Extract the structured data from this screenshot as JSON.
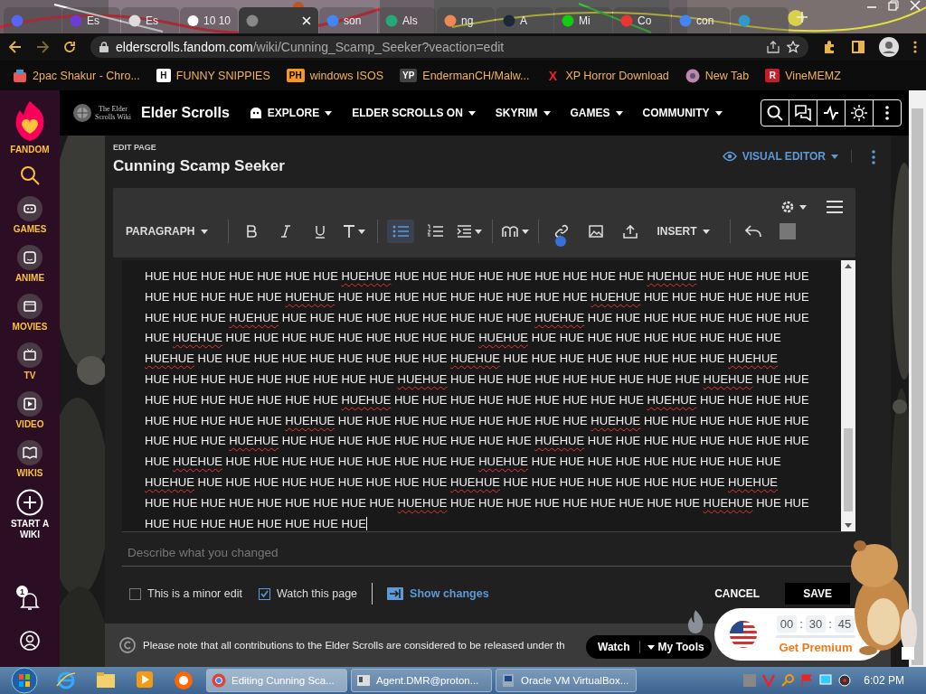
{
  "browser": {
    "tabs": [
      {
        "selected": false
      },
      {
        "label": "Es",
        "selected": false
      },
      {
        "label": "Es",
        "selected": false
      },
      {
        "label": "10 10",
        "selected": false
      },
      {
        "selected": true
      },
      {
        "label": "son",
        "selected": false
      },
      {
        "label": "Als",
        "selected": false
      },
      {
        "label": "ng",
        "selected": false
      },
      {
        "label": "A",
        "selected": false
      },
      {
        "label": "Mi",
        "selected": false
      },
      {
        "label": "Co",
        "selected": false
      },
      {
        "label": "con",
        "selected": false
      },
      {
        "selected": false
      }
    ],
    "url_host": "elderscrolls.fandom.com",
    "url_path": "/wiki/Cunning_Scamp_Seeker?veaction=edit",
    "bookmarks": [
      {
        "label": "2pac Shakur - Chro..."
      },
      {
        "label": "FUNNY SNIPPIES",
        "icon_text": "H"
      },
      {
        "label": "windows ISOS",
        "icon_text": "PH"
      },
      {
        "label": "EndermanCH/Malw...",
        "icon_text": "YP"
      },
      {
        "label": "XP Horror Download",
        "icon_text": "X"
      },
      {
        "label": "New Tab"
      },
      {
        "label": "VineMEMZ",
        "icon_text": "R"
      }
    ]
  },
  "rail": {
    "brand": "FANDOM",
    "items": [
      {
        "label": "GAMES",
        "kind": "games"
      },
      {
        "label": "ANIME",
        "kind": "anime"
      },
      {
        "label": "MOVIES",
        "kind": "movies"
      },
      {
        "label": "TV",
        "kind": "tv"
      },
      {
        "label": "VIDEO",
        "kind": "video"
      },
      {
        "label": "WIKIS",
        "kind": "wikis"
      },
      {
        "label": "START A WIKI",
        "kind": "start"
      }
    ],
    "notification_count": "1"
  },
  "nav": {
    "logo": "The Elder Scrolls Wiki",
    "site": "Elder Scrolls",
    "menus": [
      "EXPLORE",
      "ELDER SCROLLS ON",
      "SKYRIM",
      "GAMES",
      "COMMUNITY"
    ]
  },
  "editor": {
    "overline": "EDIT PAGE",
    "title": "Cunning Scamp Seeker",
    "mode": "VISUAL EDITOR",
    "format": "PARAGRAPH",
    "insert": "INSERT",
    "lists": [
      {
        "kind": "bullet",
        "selected": true
      },
      {
        "kind": "numbered",
        "selected": false
      }
    ],
    "lines": [
      [
        {
          "text": "HUE HUE HUE HUE HUE HUE HUE ",
          "misspelled": false
        },
        {
          "text": "HUEHUE",
          "misspelled": true
        },
        {
          "text": " HUE HUE HUE HUE HUE HUE HUE HUE HUE ",
          "misspelled": false
        },
        {
          "text": "HUEHUE",
          "misspelled": true
        },
        {
          "text": " HUE HUE HUE HUE",
          "misspelled": false
        }
      ],
      [
        {
          "text": "HUE HUE HUE HUE HUE ",
          "misspelled": false
        },
        {
          "text": "HUEHUE",
          "misspelled": true
        },
        {
          "text": " HUE HUE HUE HUE HUE HUE HUE HUE HUE ",
          "misspelled": false
        },
        {
          "text": "HUEHUE",
          "misspelled": true
        },
        {
          "text": " HUE HUE HUE HUE HUE HUE",
          "misspelled": false
        }
      ],
      [
        {
          "text": "HUE HUE HUE ",
          "misspelled": false
        },
        {
          "text": "HUEHUE",
          "misspelled": true
        },
        {
          "text": " HUE HUE HUE HUE HUE HUE HUE HUE HUE ",
          "misspelled": false
        },
        {
          "text": "HUEHUE",
          "misspelled": true
        },
        {
          "text": " HUE HUE HUE HUE HUE HUE HUE HUE",
          "misspelled": false
        }
      ],
      [
        {
          "text": "HUE ",
          "misspelled": false
        },
        {
          "text": "HUEHUE",
          "misspelled": true
        },
        {
          "text": " HUE HUE HUE HUE HUE HUE HUE HUE HUE ",
          "misspelled": false
        },
        {
          "text": "HUEHUE",
          "misspelled": true
        },
        {
          "text": " HUE HUE HUE HUE HUE HUE HUE HUE HUE",
          "misspelled": false
        }
      ],
      [
        {
          "text": "HUEHUE",
          "misspelled": true
        },
        {
          "text": " HUE HUE HUE HUE HUE HUE HUE HUE HUE ",
          "misspelled": false
        },
        {
          "text": "HUEHUE",
          "misspelled": true
        },
        {
          "text": " HUE HUE HUE HUE HUE HUE HUE HUE ",
          "misspelled": false
        },
        {
          "text": "HUEHUE",
          "misspelled": true
        }
      ],
      [
        {
          "text": "HUE HUE HUE HUE HUE HUE HUE HUE HUE ",
          "misspelled": false
        },
        {
          "text": "HUEHUE",
          "misspelled": true
        },
        {
          "text": " HUE HUE HUE HUE HUE HUE HUE HUE HUE ",
          "misspelled": false
        },
        {
          "text": "HUEHUE",
          "misspelled": true
        },
        {
          "text": " HUE HUE",
          "misspelled": false
        }
      ],
      [
        {
          "text": "HUE HUE HUE HUE HUE HUE HUE ",
          "misspelled": false
        },
        {
          "text": "HUEHUE",
          "misspelled": true
        },
        {
          "text": " HUE HUE HUE HUE HUE HUE HUE HUE HUE ",
          "misspelled": false
        },
        {
          "text": "HUEHUE",
          "misspelled": true
        },
        {
          "text": " HUE HUE HUE HUE",
          "misspelled": false
        }
      ],
      [
        {
          "text": "HUE HUE HUE HUE HUE ",
          "misspelled": false
        },
        {
          "text": "HUEHUE",
          "misspelled": true
        },
        {
          "text": " HUE HUE HUE HUE HUE HUE HUE HUE HUE ",
          "misspelled": false
        },
        {
          "text": "HUEHUE",
          "misspelled": true
        },
        {
          "text": " HUE HUE HUE HUE HUE HUE",
          "misspelled": false
        }
      ],
      [
        {
          "text": "HUE HUE HUE ",
          "misspelled": false
        },
        {
          "text": "HUEHUE",
          "misspelled": true
        },
        {
          "text": " HUE HUE HUE HUE HUE HUE HUE HUE HUE ",
          "misspelled": false
        },
        {
          "text": "HUEHUE",
          "misspelled": true
        },
        {
          "text": " HUE HUE HUE HUE HUE HUE HUE HUE",
          "misspelled": false
        }
      ],
      [
        {
          "text": "HUE ",
          "misspelled": false
        },
        {
          "text": "HUEHUE",
          "misspelled": true
        },
        {
          "text": " HUE HUE HUE HUE HUE HUE HUE HUE HUE ",
          "misspelled": false
        },
        {
          "text": "HUEHUE",
          "misspelled": true
        },
        {
          "text": " HUE HUE HUE HUE HUE HUE HUE HUE HUE",
          "misspelled": false
        }
      ],
      [
        {
          "text": "HUEHUE",
          "misspelled": true
        },
        {
          "text": " HUE HUE HUE HUE HUE HUE HUE HUE HUE ",
          "misspelled": false
        },
        {
          "text": "HUEHUE",
          "misspelled": true
        },
        {
          "text": " HUE HUE HUE HUE HUE HUE HUE HUE ",
          "misspelled": false
        },
        {
          "text": "HUEHUE",
          "misspelled": true
        }
      ],
      [
        {
          "text": "HUE HUE HUE HUE HUE HUE HUE HUE HUE ",
          "misspelled": false
        },
        {
          "text": "HUEHUE",
          "misspelled": true
        },
        {
          "text": " HUE HUE HUE HUE HUE HUE HUE HUE HUE ",
          "misspelled": false
        },
        {
          "text": "HUEHUE",
          "misspelled": true
        },
        {
          "text": " HUE HUE",
          "misspelled": false
        }
      ],
      [
        {
          "text": "HUE HUE HUE HUE HUE HUE HUE HUE",
          "misspelled": false
        }
      ]
    ],
    "summary_placeholder": "Describe what you changed",
    "options": [
      {
        "label": "This is a minor edit",
        "checked": false
      },
      {
        "label": "Watch this page",
        "checked": true
      }
    ],
    "show_changes": "Show changes",
    "cancel": "CANCEL",
    "save": "SAVE",
    "notice": "Please note that all contributions to the Elder Scrolls are considered to be released under th"
  },
  "overlays": {
    "watch": "Watch",
    "tools": "My Tools",
    "timer": [
      "00",
      "30",
      "45"
    ],
    "timer_separator": ":",
    "premium": "Get Premium"
  },
  "taskbar": {
    "tasks": [
      {
        "label": "Editing Cunning Sca...",
        "selected": true
      },
      {
        "label": "Agent.DMR@proton...",
        "selected": false
      },
      {
        "label": "Oracle VM VirtualBox...",
        "selected": false
      }
    ],
    "clock": "6:02 PM"
  }
}
